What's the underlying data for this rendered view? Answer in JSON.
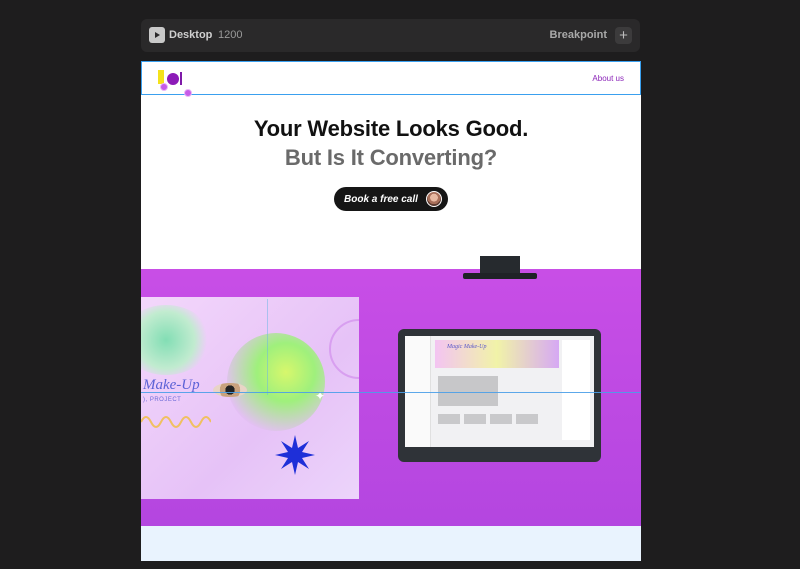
{
  "toolbar": {
    "device_label": "Desktop",
    "width_value": "1200",
    "breakpoint_label": "Breakpoint",
    "add_label": "+"
  },
  "site": {
    "nav": {
      "about_link": "About us"
    },
    "hero": {
      "title_line1": "Your Website Looks Good.",
      "title_line2": "But Is It Converting?",
      "cta_label": "Book a free call"
    },
    "showcase": {
      "art_title": "Make-Up",
      "art_subtitle": "), PROJECT",
      "screen_title": "Magic Make-Up"
    }
  },
  "colors": {
    "editor_bg": "#1e1d1e",
    "accent_purple": "#c84ee6",
    "selection_blue": "#3aa0ef",
    "logo_yellow": "#f4e21b",
    "logo_purple": "#8c1bb8"
  }
}
